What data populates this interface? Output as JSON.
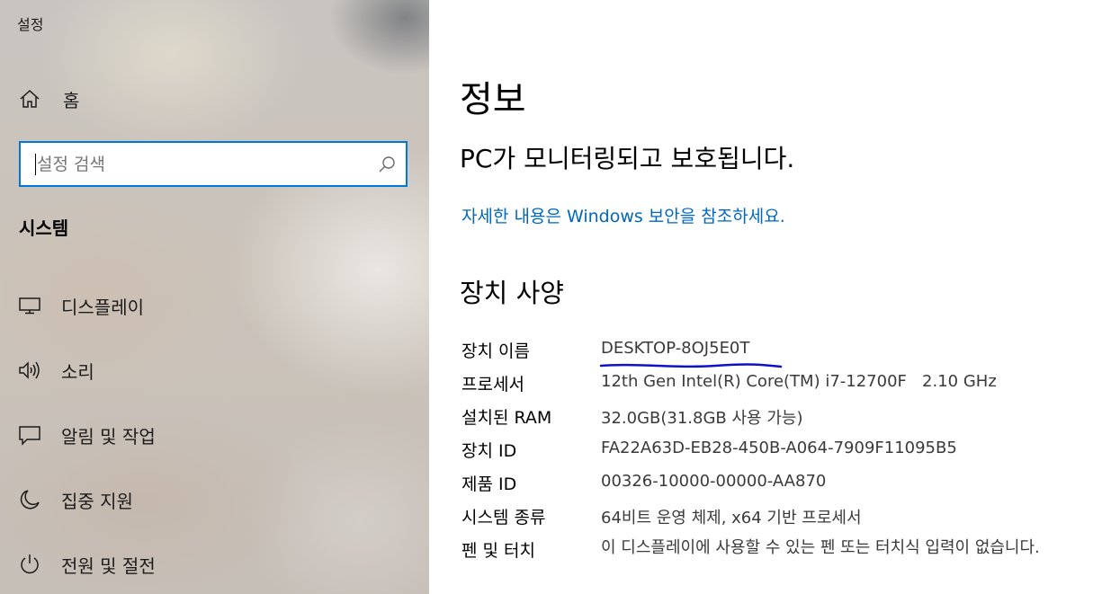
{
  "window": {
    "title": "설정"
  },
  "sidebar": {
    "home_label": "홈",
    "search": {
      "placeholder": "설정 검색",
      "value": ""
    },
    "section_header": "시스템",
    "items": [
      {
        "label": "디스플레이",
        "icon": "monitor-icon"
      },
      {
        "label": "소리",
        "icon": "speaker-icon"
      },
      {
        "label": "알림 및 작업",
        "icon": "notification-icon"
      },
      {
        "label": "집중 지원",
        "icon": "moon-icon"
      },
      {
        "label": "전원 및 절전",
        "icon": "power-icon"
      }
    ]
  },
  "main": {
    "title": "정보",
    "status": "PC가 모니터링되고 보호됩니다.",
    "link": "자세한 내용은 Windows 보안을 참조하세요.",
    "specs_title": "장치 사양",
    "specs": [
      {
        "key": "장치 이름",
        "value": "DESKTOP-8OJ5E0T"
      },
      {
        "key": "프로세서",
        "value": "12th Gen Intel(R) Core(TM) i7-12700F   2.10 GHz"
      },
      {
        "key": "설치된 RAM",
        "value": "32.0GB(31.8GB 사용 가능)"
      },
      {
        "key": "장치 ID",
        "value": "FA22A63D-EB28-450B-A064-7909F11095B5"
      },
      {
        "key": "제품 ID",
        "value": "00326-10000-00000-AA870"
      },
      {
        "key": "시스템 종류",
        "value": "64비트 운영 체제, x64 기반 프로세서"
      },
      {
        "key": "펜 및 터치",
        "value": "이 디스플레이에 사용할 수 있는 펜 또는 터치식 입력이 없습니다."
      }
    ]
  },
  "colors": {
    "accent": "#0078d7",
    "link": "#0067c0",
    "annotation": "#1010c8"
  }
}
